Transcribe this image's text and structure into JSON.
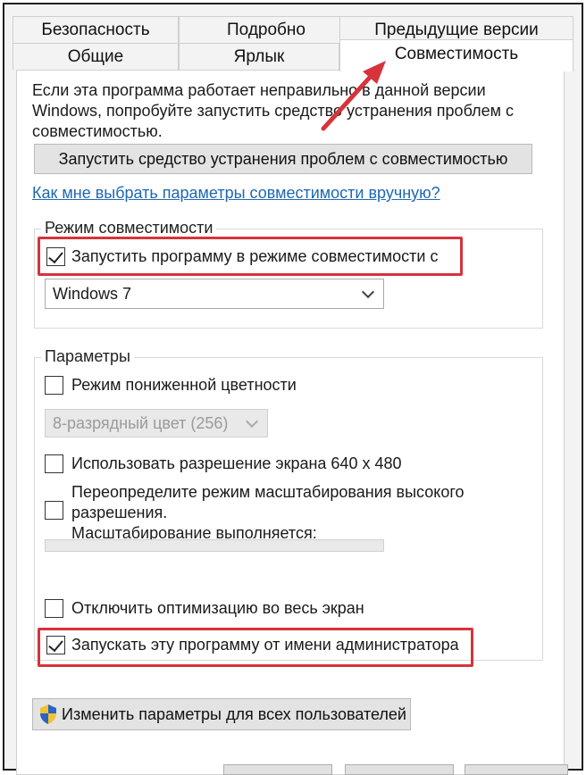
{
  "tabs": {
    "row1": [
      "Безопасность",
      "Подробно",
      "Предыдущие версии"
    ],
    "row2": [
      "Общие",
      "Ярлык",
      "Совместимость"
    ]
  },
  "description": {
    "line1": "Если эта программа работает неправильно в данной версии",
    "line2": "Windows, попробуйте запустить средство устранения проблем с",
    "line3": "совместимостью."
  },
  "troubleshoot_button": "Запустить средство устранения проблем с совместимостью",
  "manual_link": "Как мне выбрать параметры совместимости вручную?",
  "compat_mode": {
    "legend": "Режим совместимости",
    "checkbox_label": "Запустить программу в режиме совместимости с",
    "checked": true,
    "os_selected": "Windows 7"
  },
  "settings": {
    "legend": "Параметры",
    "reduced_color_label": "Режим пониженной цветности",
    "reduced_color_checked": false,
    "color_selected": "8-разрядный цвет (256)",
    "resolution_label": "Использовать разрешение экрана 640 x 480",
    "resolution_checked": false,
    "dpi_line1": "Переопределите режим масштабирования высокого",
    "dpi_line2": "разрешения.",
    "dpi_line3": "Масштабирование выполняется:",
    "dpi_checked": false,
    "fullscreen_label": "Отключить оптимизацию во весь экран",
    "fullscreen_checked": false,
    "admin_label": "Запускать эту программу от имени администратора",
    "admin_checked": true
  },
  "all_users_button": "Изменить параметры для всех пользователей",
  "colors": {
    "highlight": "#d6333b",
    "link": "#1f67b3"
  }
}
